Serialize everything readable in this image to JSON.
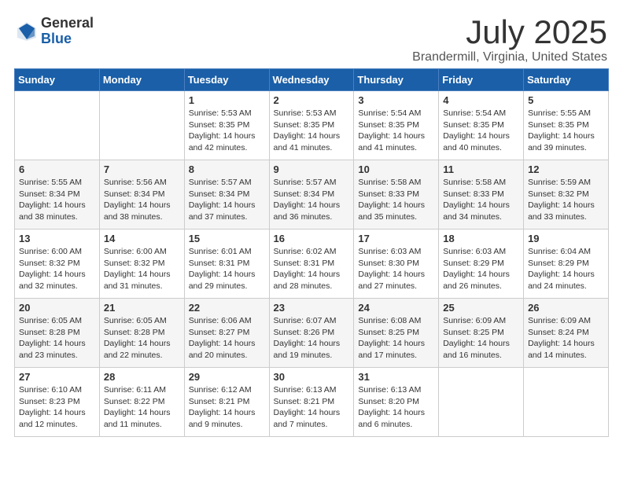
{
  "logo": {
    "general": "General",
    "blue": "Blue"
  },
  "title": {
    "month": "July 2025",
    "location": "Brandermill, Virginia, United States"
  },
  "weekdays": [
    "Sunday",
    "Monday",
    "Tuesday",
    "Wednesday",
    "Thursday",
    "Friday",
    "Saturday"
  ],
  "weeks": [
    [
      {
        "day": "",
        "info": ""
      },
      {
        "day": "",
        "info": ""
      },
      {
        "day": "1",
        "info": "Sunrise: 5:53 AM\nSunset: 8:35 PM\nDaylight: 14 hours and 42 minutes."
      },
      {
        "day": "2",
        "info": "Sunrise: 5:53 AM\nSunset: 8:35 PM\nDaylight: 14 hours and 41 minutes."
      },
      {
        "day": "3",
        "info": "Sunrise: 5:54 AM\nSunset: 8:35 PM\nDaylight: 14 hours and 41 minutes."
      },
      {
        "day": "4",
        "info": "Sunrise: 5:54 AM\nSunset: 8:35 PM\nDaylight: 14 hours and 40 minutes."
      },
      {
        "day": "5",
        "info": "Sunrise: 5:55 AM\nSunset: 8:35 PM\nDaylight: 14 hours and 39 minutes."
      }
    ],
    [
      {
        "day": "6",
        "info": "Sunrise: 5:55 AM\nSunset: 8:34 PM\nDaylight: 14 hours and 38 minutes."
      },
      {
        "day": "7",
        "info": "Sunrise: 5:56 AM\nSunset: 8:34 PM\nDaylight: 14 hours and 38 minutes."
      },
      {
        "day": "8",
        "info": "Sunrise: 5:57 AM\nSunset: 8:34 PM\nDaylight: 14 hours and 37 minutes."
      },
      {
        "day": "9",
        "info": "Sunrise: 5:57 AM\nSunset: 8:34 PM\nDaylight: 14 hours and 36 minutes."
      },
      {
        "day": "10",
        "info": "Sunrise: 5:58 AM\nSunset: 8:33 PM\nDaylight: 14 hours and 35 minutes."
      },
      {
        "day": "11",
        "info": "Sunrise: 5:58 AM\nSunset: 8:33 PM\nDaylight: 14 hours and 34 minutes."
      },
      {
        "day": "12",
        "info": "Sunrise: 5:59 AM\nSunset: 8:32 PM\nDaylight: 14 hours and 33 minutes."
      }
    ],
    [
      {
        "day": "13",
        "info": "Sunrise: 6:00 AM\nSunset: 8:32 PM\nDaylight: 14 hours and 32 minutes."
      },
      {
        "day": "14",
        "info": "Sunrise: 6:00 AM\nSunset: 8:32 PM\nDaylight: 14 hours and 31 minutes."
      },
      {
        "day": "15",
        "info": "Sunrise: 6:01 AM\nSunset: 8:31 PM\nDaylight: 14 hours and 29 minutes."
      },
      {
        "day": "16",
        "info": "Sunrise: 6:02 AM\nSunset: 8:31 PM\nDaylight: 14 hours and 28 minutes."
      },
      {
        "day": "17",
        "info": "Sunrise: 6:03 AM\nSunset: 8:30 PM\nDaylight: 14 hours and 27 minutes."
      },
      {
        "day": "18",
        "info": "Sunrise: 6:03 AM\nSunset: 8:29 PM\nDaylight: 14 hours and 26 minutes."
      },
      {
        "day": "19",
        "info": "Sunrise: 6:04 AM\nSunset: 8:29 PM\nDaylight: 14 hours and 24 minutes."
      }
    ],
    [
      {
        "day": "20",
        "info": "Sunrise: 6:05 AM\nSunset: 8:28 PM\nDaylight: 14 hours and 23 minutes."
      },
      {
        "day": "21",
        "info": "Sunrise: 6:05 AM\nSunset: 8:28 PM\nDaylight: 14 hours and 22 minutes."
      },
      {
        "day": "22",
        "info": "Sunrise: 6:06 AM\nSunset: 8:27 PM\nDaylight: 14 hours and 20 minutes."
      },
      {
        "day": "23",
        "info": "Sunrise: 6:07 AM\nSunset: 8:26 PM\nDaylight: 14 hours and 19 minutes."
      },
      {
        "day": "24",
        "info": "Sunrise: 6:08 AM\nSunset: 8:25 PM\nDaylight: 14 hours and 17 minutes."
      },
      {
        "day": "25",
        "info": "Sunrise: 6:09 AM\nSunset: 8:25 PM\nDaylight: 14 hours and 16 minutes."
      },
      {
        "day": "26",
        "info": "Sunrise: 6:09 AM\nSunset: 8:24 PM\nDaylight: 14 hours and 14 minutes."
      }
    ],
    [
      {
        "day": "27",
        "info": "Sunrise: 6:10 AM\nSunset: 8:23 PM\nDaylight: 14 hours and 12 minutes."
      },
      {
        "day": "28",
        "info": "Sunrise: 6:11 AM\nSunset: 8:22 PM\nDaylight: 14 hours and 11 minutes."
      },
      {
        "day": "29",
        "info": "Sunrise: 6:12 AM\nSunset: 8:21 PM\nDaylight: 14 hours and 9 minutes."
      },
      {
        "day": "30",
        "info": "Sunrise: 6:13 AM\nSunset: 8:21 PM\nDaylight: 14 hours and 7 minutes."
      },
      {
        "day": "31",
        "info": "Sunrise: 6:13 AM\nSunset: 8:20 PM\nDaylight: 14 hours and 6 minutes."
      },
      {
        "day": "",
        "info": ""
      },
      {
        "day": "",
        "info": ""
      }
    ]
  ]
}
